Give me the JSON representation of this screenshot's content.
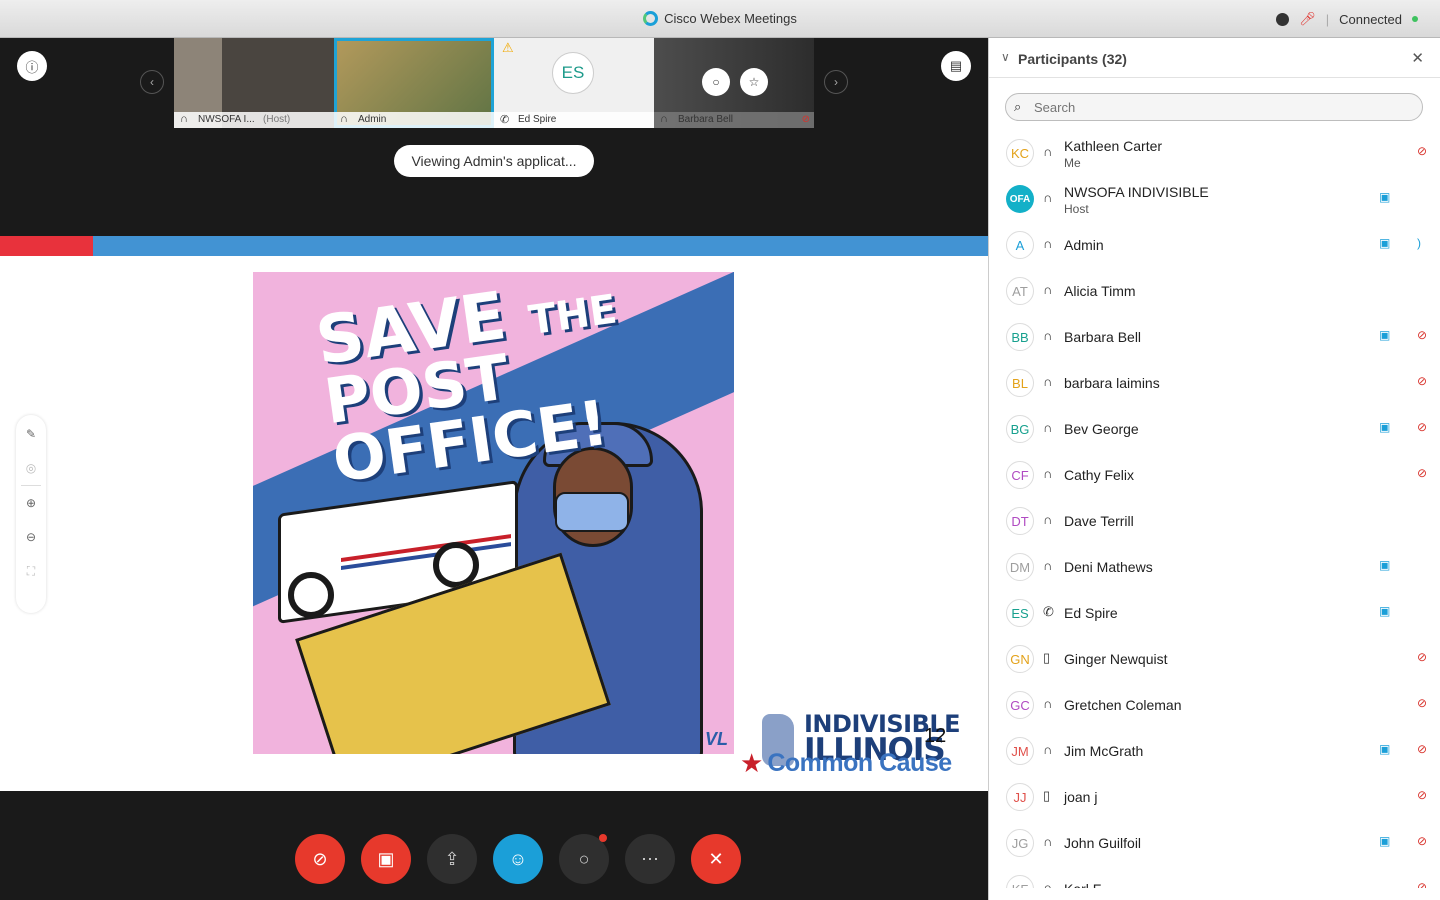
{
  "window": {
    "title": "Cisco Webex Meetings",
    "status": "Connected"
  },
  "video_strip": {
    "tiles": [
      {
        "name": "NWSOFA I...",
        "role": "(Host)"
      },
      {
        "name": "Admin",
        "role": ""
      },
      {
        "name": "Ed Spire",
        "role": "",
        "initials": "ES"
      },
      {
        "name": "Barbara Bell",
        "role": ""
      }
    ]
  },
  "viewing_banner": "Viewing Admin's applicat...",
  "slide": {
    "poster_line1_a": "SAVE",
    "poster_line1_b": "THE",
    "poster_line2": "POST OFFICE!",
    "corner_mark": "VL",
    "brand_line1": "INDIVISIBLE",
    "brand_line2": "ILLINOIS",
    "page_number": "12",
    "partner": "Common Cause"
  },
  "participants_panel": {
    "title": "Participants (32)",
    "search_placeholder": "Search",
    "participants": [
      {
        "initials": "KC",
        "name": "Kathleen Carter",
        "role": "Me",
        "connection": "headset",
        "video": false,
        "muted": true,
        "color": "#e3a21a"
      },
      {
        "initials": "OFA",
        "name": "NWSOFA INDIVISIBLE",
        "role": "Host",
        "connection": "headset",
        "video": true,
        "muted": false,
        "color": "#13b0c8"
      },
      {
        "initials": "A",
        "name": "Admin",
        "role": "",
        "connection": "headset",
        "video": true,
        "muted": false,
        "speaking": true,
        "color": "#1b9fd8"
      },
      {
        "initials": "AT",
        "name": "Alicia Timm",
        "role": "",
        "connection": "headset",
        "video": false,
        "muted": false,
        "color": "#9e9e9e"
      },
      {
        "initials": "BB",
        "name": "Barbara Bell",
        "role": "",
        "connection": "headset",
        "video": true,
        "muted": true,
        "color": "#17a08e"
      },
      {
        "initials": "BL",
        "name": "barbara laimins",
        "role": "",
        "connection": "headset",
        "video": false,
        "muted": true,
        "color": "#e3a21a"
      },
      {
        "initials": "BG",
        "name": "Bev George",
        "role": "",
        "connection": "headset",
        "video": true,
        "muted": true,
        "color": "#17a08e"
      },
      {
        "initials": "CF",
        "name": "Cathy Felix",
        "role": "",
        "connection": "headset",
        "video": false,
        "muted": true,
        "color": "#b04ac2"
      },
      {
        "initials": "DT",
        "name": "Dave Terrill",
        "role": "",
        "connection": "headset",
        "video": false,
        "muted": false,
        "color": "#b04ac2"
      },
      {
        "initials": "DM",
        "name": "Deni Mathews",
        "role": "",
        "connection": "headset",
        "video": true,
        "muted": false,
        "color": "#9e9e9e"
      },
      {
        "initials": "ES",
        "name": "Ed Spire",
        "role": "",
        "connection": "phone",
        "video": true,
        "muted": false,
        "color": "#17a08e"
      },
      {
        "initials": "GN",
        "name": "Ginger Newquist",
        "role": "",
        "connection": "mobile",
        "video": false,
        "muted": true,
        "color": "#e3a21a"
      },
      {
        "initials": "GC",
        "name": "Gretchen Coleman",
        "role": "",
        "connection": "headset",
        "video": false,
        "muted": true,
        "color": "#b04ac2"
      },
      {
        "initials": "JM",
        "name": "Jim McGrath",
        "role": "",
        "connection": "headset",
        "video": true,
        "muted": true,
        "color": "#e0504a"
      },
      {
        "initials": "JJ",
        "name": "joan j",
        "role": "",
        "connection": "mobile",
        "video": false,
        "muted": true,
        "color": "#e0504a"
      },
      {
        "initials": "JG",
        "name": "John Guilfoil",
        "role": "",
        "connection": "headset",
        "video": true,
        "muted": true,
        "color": "#9e9e9e"
      },
      {
        "initials": "KF",
        "name": "Karl F",
        "role": "",
        "connection": "headset",
        "video": false,
        "muted": true,
        "color": "#9e9e9e"
      }
    ]
  },
  "icons": {
    "headset": "headset-icon",
    "phone": "phone-icon",
    "mobile": "mobile-icon",
    "video": "video-icon",
    "muted": "muted-mic-icon"
  }
}
